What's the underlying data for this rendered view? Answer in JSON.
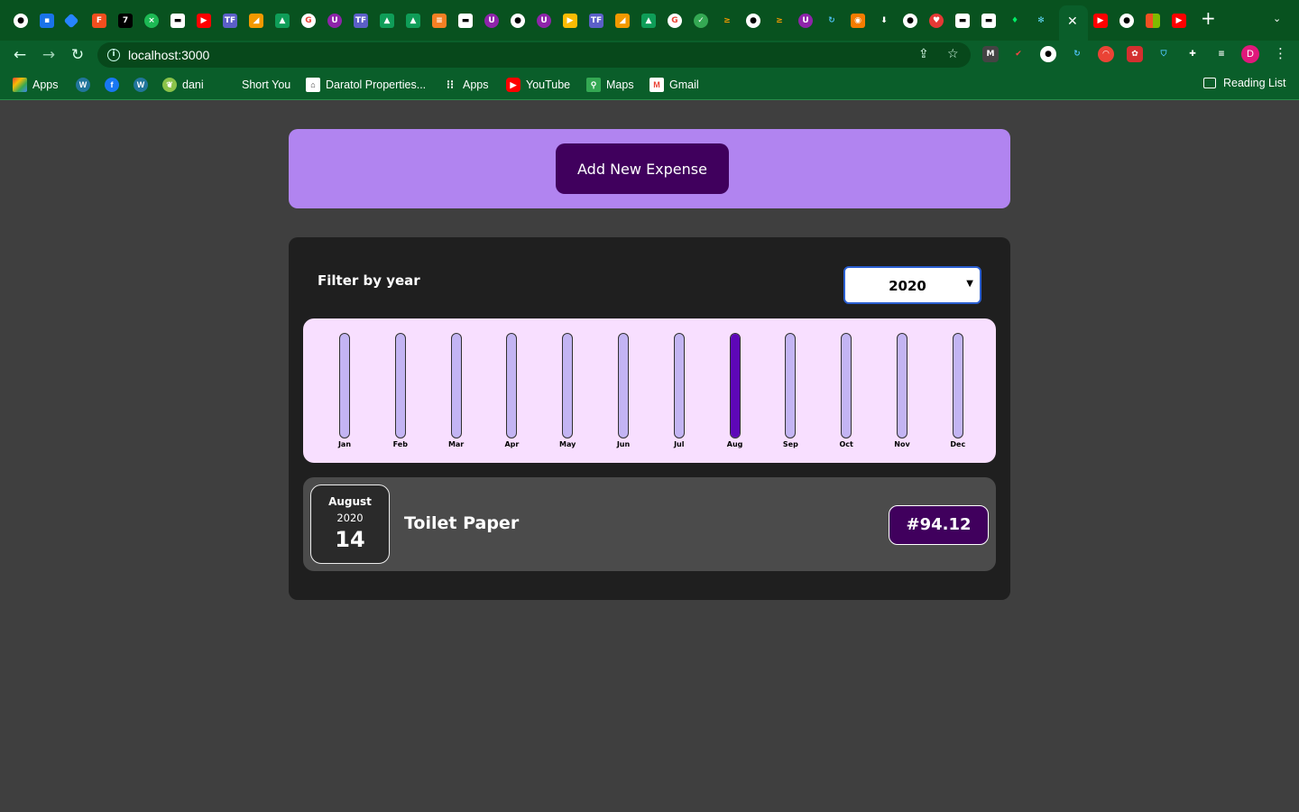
{
  "browser": {
    "url": "localhost:3000",
    "profile_initial": "D",
    "reading_list": "Reading List",
    "bookmarks": [
      {
        "label": "Apps",
        "icon": "apps-grid-icon"
      },
      {
        "label": "",
        "icon": "wordpress-icon"
      },
      {
        "label": "",
        "icon": "facebook-icon"
      },
      {
        "label": "",
        "icon": "wordpress-icon"
      },
      {
        "label": "dani",
        "icon": "leaf-icon"
      },
      {
        "label": "Short You",
        "icon": ""
      },
      {
        "label": "Daratol Properties...",
        "icon": "property-icon"
      },
      {
        "label": "Apps",
        "icon": "apps-grid-icon"
      },
      {
        "label": "YouTube",
        "icon": "youtube-icon"
      },
      {
        "label": "Maps",
        "icon": "maps-icon"
      },
      {
        "label": "Gmail",
        "icon": "gmail-icon"
      }
    ],
    "colors": {
      "chrome": "#0a5e2a",
      "tabstrip": "#08521f"
    }
  },
  "new_expense": {
    "button_label": "Add New Expense",
    "color": "#b184f0",
    "button_color": "#40005d"
  },
  "filter": {
    "label": "Filter by year",
    "selected_year": "2020"
  },
  "chart_data": {
    "type": "bar",
    "categories": [
      "Jan",
      "Feb",
      "Mar",
      "Apr",
      "May",
      "Jun",
      "Jul",
      "Aug",
      "Sep",
      "Oct",
      "Nov",
      "Dec"
    ],
    "values": [
      0,
      0,
      0,
      0,
      0,
      0,
      0,
      94.12,
      0,
      0,
      0,
      0
    ],
    "ylim": [
      0,
      94.12
    ]
  },
  "expenses": [
    {
      "month": "August",
      "year": "2020",
      "day": "14",
      "title": "Toilet Paper",
      "amount": "#94.12"
    }
  ]
}
